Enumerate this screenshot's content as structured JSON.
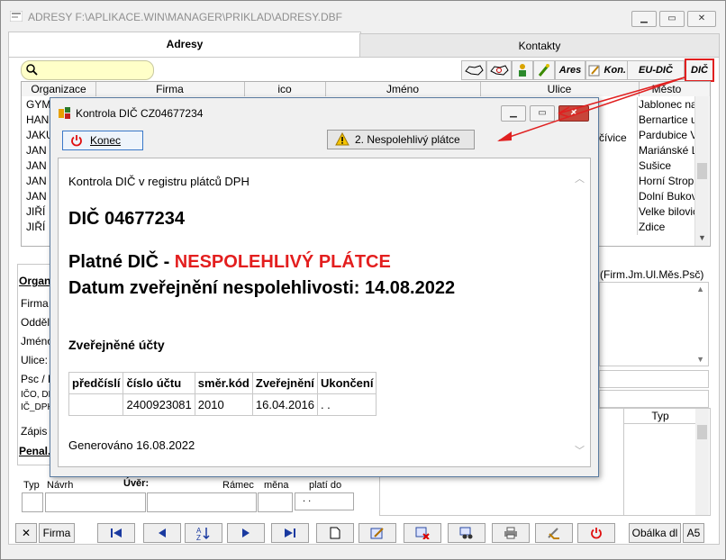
{
  "window": {
    "title": "ADRESY F:\\APLIKACE.WIN\\MANAGER\\PRIKLAD\\ADRESY.DBF"
  },
  "tabs": [
    {
      "label": "Adresy"
    },
    {
      "label": "Kontakty"
    }
  ],
  "search": {
    "value": ""
  },
  "toolbar": {
    "ares": "Ares",
    "kon": "Kon.",
    "eu_dic": "EU-DIČ",
    "dic": "DIČ"
  },
  "grid": {
    "columns": [
      "Organizace",
      "Firma",
      "ico",
      "Jméno",
      "Ulice",
      "Město"
    ],
    "left_cells": [
      "GYM",
      "HAN",
      "JAKU",
      "JAN",
      "JAN",
      "JAN",
      "JAN",
      "JIŘÍ",
      "JIŘÍ"
    ],
    "right_cells": [
      "Jablonec na",
      "Bernartice u",
      "Pardubice V",
      "Mariánské L",
      "Sušice",
      "Horní Stropn",
      "Dolní Bukov",
      "Velke bilovic",
      "Zdice"
    ],
    "ulice_fragment": "čívice"
  },
  "form": {
    "organ_label": "Organ",
    "labels": [
      "Firma",
      "Odděl",
      "Jméno",
      "Ulice:",
      "Psc / N",
      "IČO, DI",
      "IČ_DPH",
      "Zápis"
    ],
    "penal_label": "Penal.",
    "hint": "(Firm.Jm.Ul.Měs.Psč)",
    "typ_header": "Typ",
    "bottom_labels": {
      "typ": "Typ",
      "navrh": "Návrh",
      "uver": "Úvěr:",
      "ramec": "Rámec",
      "mena": "měna",
      "plati_do": "platí do",
      "plati_value": ". ."
    }
  },
  "bottom_toolbar": {
    "firma": "Firma",
    "obalka": "Obálka dl",
    "a5": "A5"
  },
  "dialog": {
    "title": "Kontrola DIČ CZ04677234",
    "konec": "Konec",
    "nespolehlivy_btn": "2. Nespolehlivý plátce",
    "body": {
      "heading_small": "Kontrola DIČ v registru plátců DPH",
      "dic_line": "DIČ 04677234",
      "platne_prefix": "Platné DIČ - ",
      "platne_status": "NESPOLEHLIVÝ PLÁTCE",
      "datum_line": "Datum zveřejnění nespolehlivosti: 14.08.2022",
      "ucty_heading": "Zveřejněné účty",
      "table_headers": [
        "předčíslí",
        "číslo účtu",
        "směr.kód",
        "Zveřejnění",
        "Ukončení"
      ],
      "table_rows": [
        [
          "",
          "2400923081",
          "2010",
          "16.04.2016",
          ". ."
        ]
      ],
      "generated": "Generováno 16.08.2022"
    }
  },
  "colors": {
    "status_red": "#e31e1e",
    "arrow_red": "#e02020",
    "search_bg": "#ffffc8"
  }
}
